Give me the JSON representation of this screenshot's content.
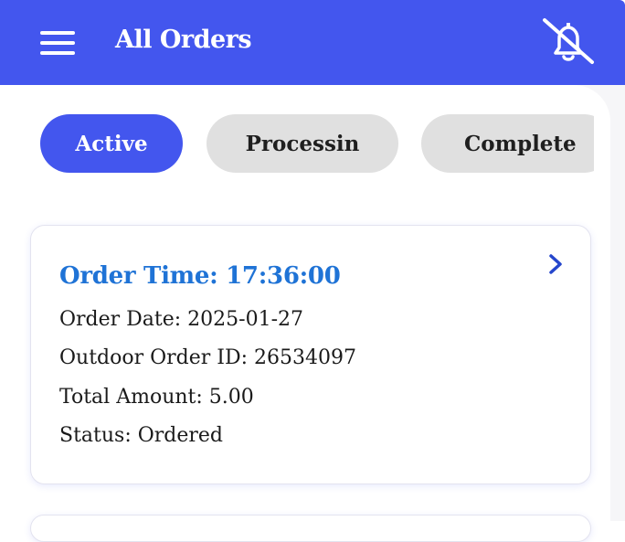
{
  "header": {
    "title": "All Orders",
    "menu_icon": "hamburger-menu-icon",
    "notification_icon": "bell-off-icon"
  },
  "tabs": [
    {
      "label": "Active",
      "selected": true
    },
    {
      "label": "Processin",
      "selected": false
    },
    {
      "label": "Complete",
      "selected": false
    }
  ],
  "order": {
    "time": "Order Time: 17:36:00",
    "date": "Order Date: 2025-01-27",
    "outdoor_id": "Outdoor Order ID: 26534097",
    "total": "Total Amount: 5.00",
    "status": "Status: Ordered"
  },
  "colors": {
    "brand": "#4356ee",
    "order_time": "#1f73d6",
    "tab_inactive": "#e0e0e0"
  }
}
